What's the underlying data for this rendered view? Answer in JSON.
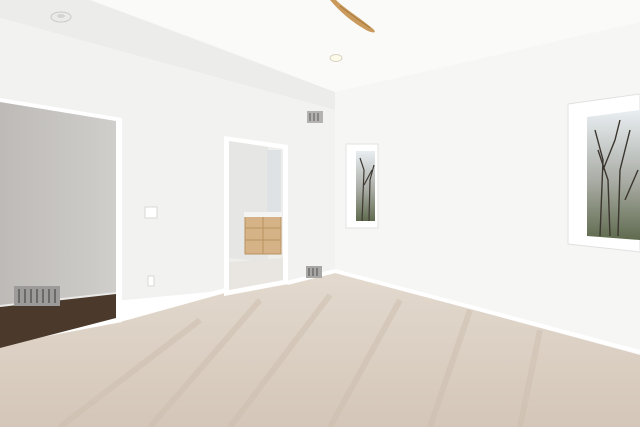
{
  "scene": {
    "description_id": "empty-bedroom",
    "colors": {
      "wall_left": "#f3f3f2",
      "wall_right": "#f5f5f4",
      "ceiling": "#f7f7f6",
      "carpet": "#ddd2c6",
      "closet_wall": "#c9c7c5",
      "wood_floor": "#4a3a2c",
      "vanity": "#d6b387",
      "fan_blade": "#c99a5c",
      "trim": "#ffffff"
    },
    "icons": [
      "ceiling-fan-icon",
      "recessed-light-icon",
      "smoke-detector-icon",
      "hvac-vent-icon",
      "light-switch-icon",
      "outlet-icon"
    ]
  }
}
